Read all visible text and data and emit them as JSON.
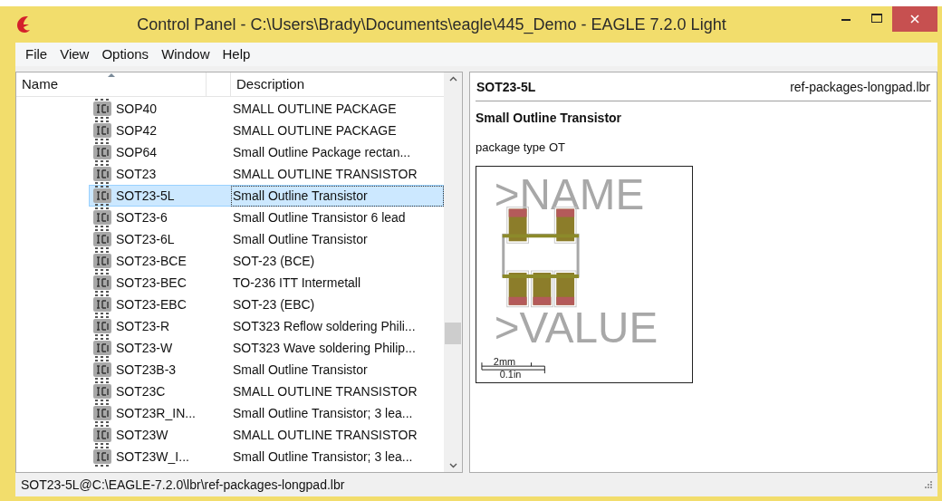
{
  "window": {
    "title": "Control Panel - C:\\Users\\Brady\\Documents\\eagle\\445_Demo - EAGLE 7.2.0 Light"
  },
  "menu": [
    "File",
    "View",
    "Options",
    "Window",
    "Help"
  ],
  "table": {
    "columns": [
      "Name",
      "Description"
    ],
    "rows": [
      {
        "name": "SOP40",
        "description": "SMALL OUTLINE PACKAGE",
        "selected": false
      },
      {
        "name": "SOP42",
        "description": "SMALL OUTLINE PACKAGE",
        "selected": false
      },
      {
        "name": "SOP64",
        "description": "Small Outline Package rectan...",
        "selected": false
      },
      {
        "name": "SOT23",
        "description": "SMALL OUTLINE TRANSISTOR",
        "selected": false
      },
      {
        "name": "SOT23-5L",
        "description": "Small Outline Transistor",
        "selected": true
      },
      {
        "name": "SOT23-6",
        "description": "Small Outline Transistor 6 lead",
        "selected": false
      },
      {
        "name": "SOT23-6L",
        "description": "Small Outline Transistor",
        "selected": false
      },
      {
        "name": "SOT23-BCE",
        "description": "SOT-23 (BCE)",
        "selected": false
      },
      {
        "name": "SOT23-BEC",
        "description": "TO-236 ITT Intermetall",
        "selected": false
      },
      {
        "name": "SOT23-EBC",
        "description": "SOT-23 (EBC)",
        "selected": false
      },
      {
        "name": "SOT23-R",
        "description": "SOT323 Reflow soldering Phili...",
        "selected": false
      },
      {
        "name": "SOT23-W",
        "description": "SOT323 Wave soldering Philip...",
        "selected": false
      },
      {
        "name": "SOT23B-3",
        "description": "Small Outline Transistor",
        "selected": false
      },
      {
        "name": "SOT23C",
        "description": "SMALL OUTLINE TRANSISTOR",
        "selected": false
      },
      {
        "name": "SOT23R_IN...",
        "description": "Small Outline Transistor; 3 lea...",
        "selected": false
      },
      {
        "name": "SOT23W",
        "description": "SMALL OUTLINE TRANSISTOR",
        "selected": false
      },
      {
        "name": "SOT23W_I...",
        "description": "Small Outline Transistor; 3 lea...",
        "selected": false
      }
    ]
  },
  "preview": {
    "name": "SOT23-5L",
    "library": "ref-packages-longpad.lbr",
    "title": "Small Outline Transistor",
    "description": "package type OT",
    "name_label": ">NAME",
    "value_label": ">VALUE",
    "scale_mm": "2mm",
    "scale_in": "0.1in"
  },
  "status_bar": "SOT23-5L@C:\\EAGLE-7.2.0\\lbr\\ref-packages-longpad.lbr"
}
